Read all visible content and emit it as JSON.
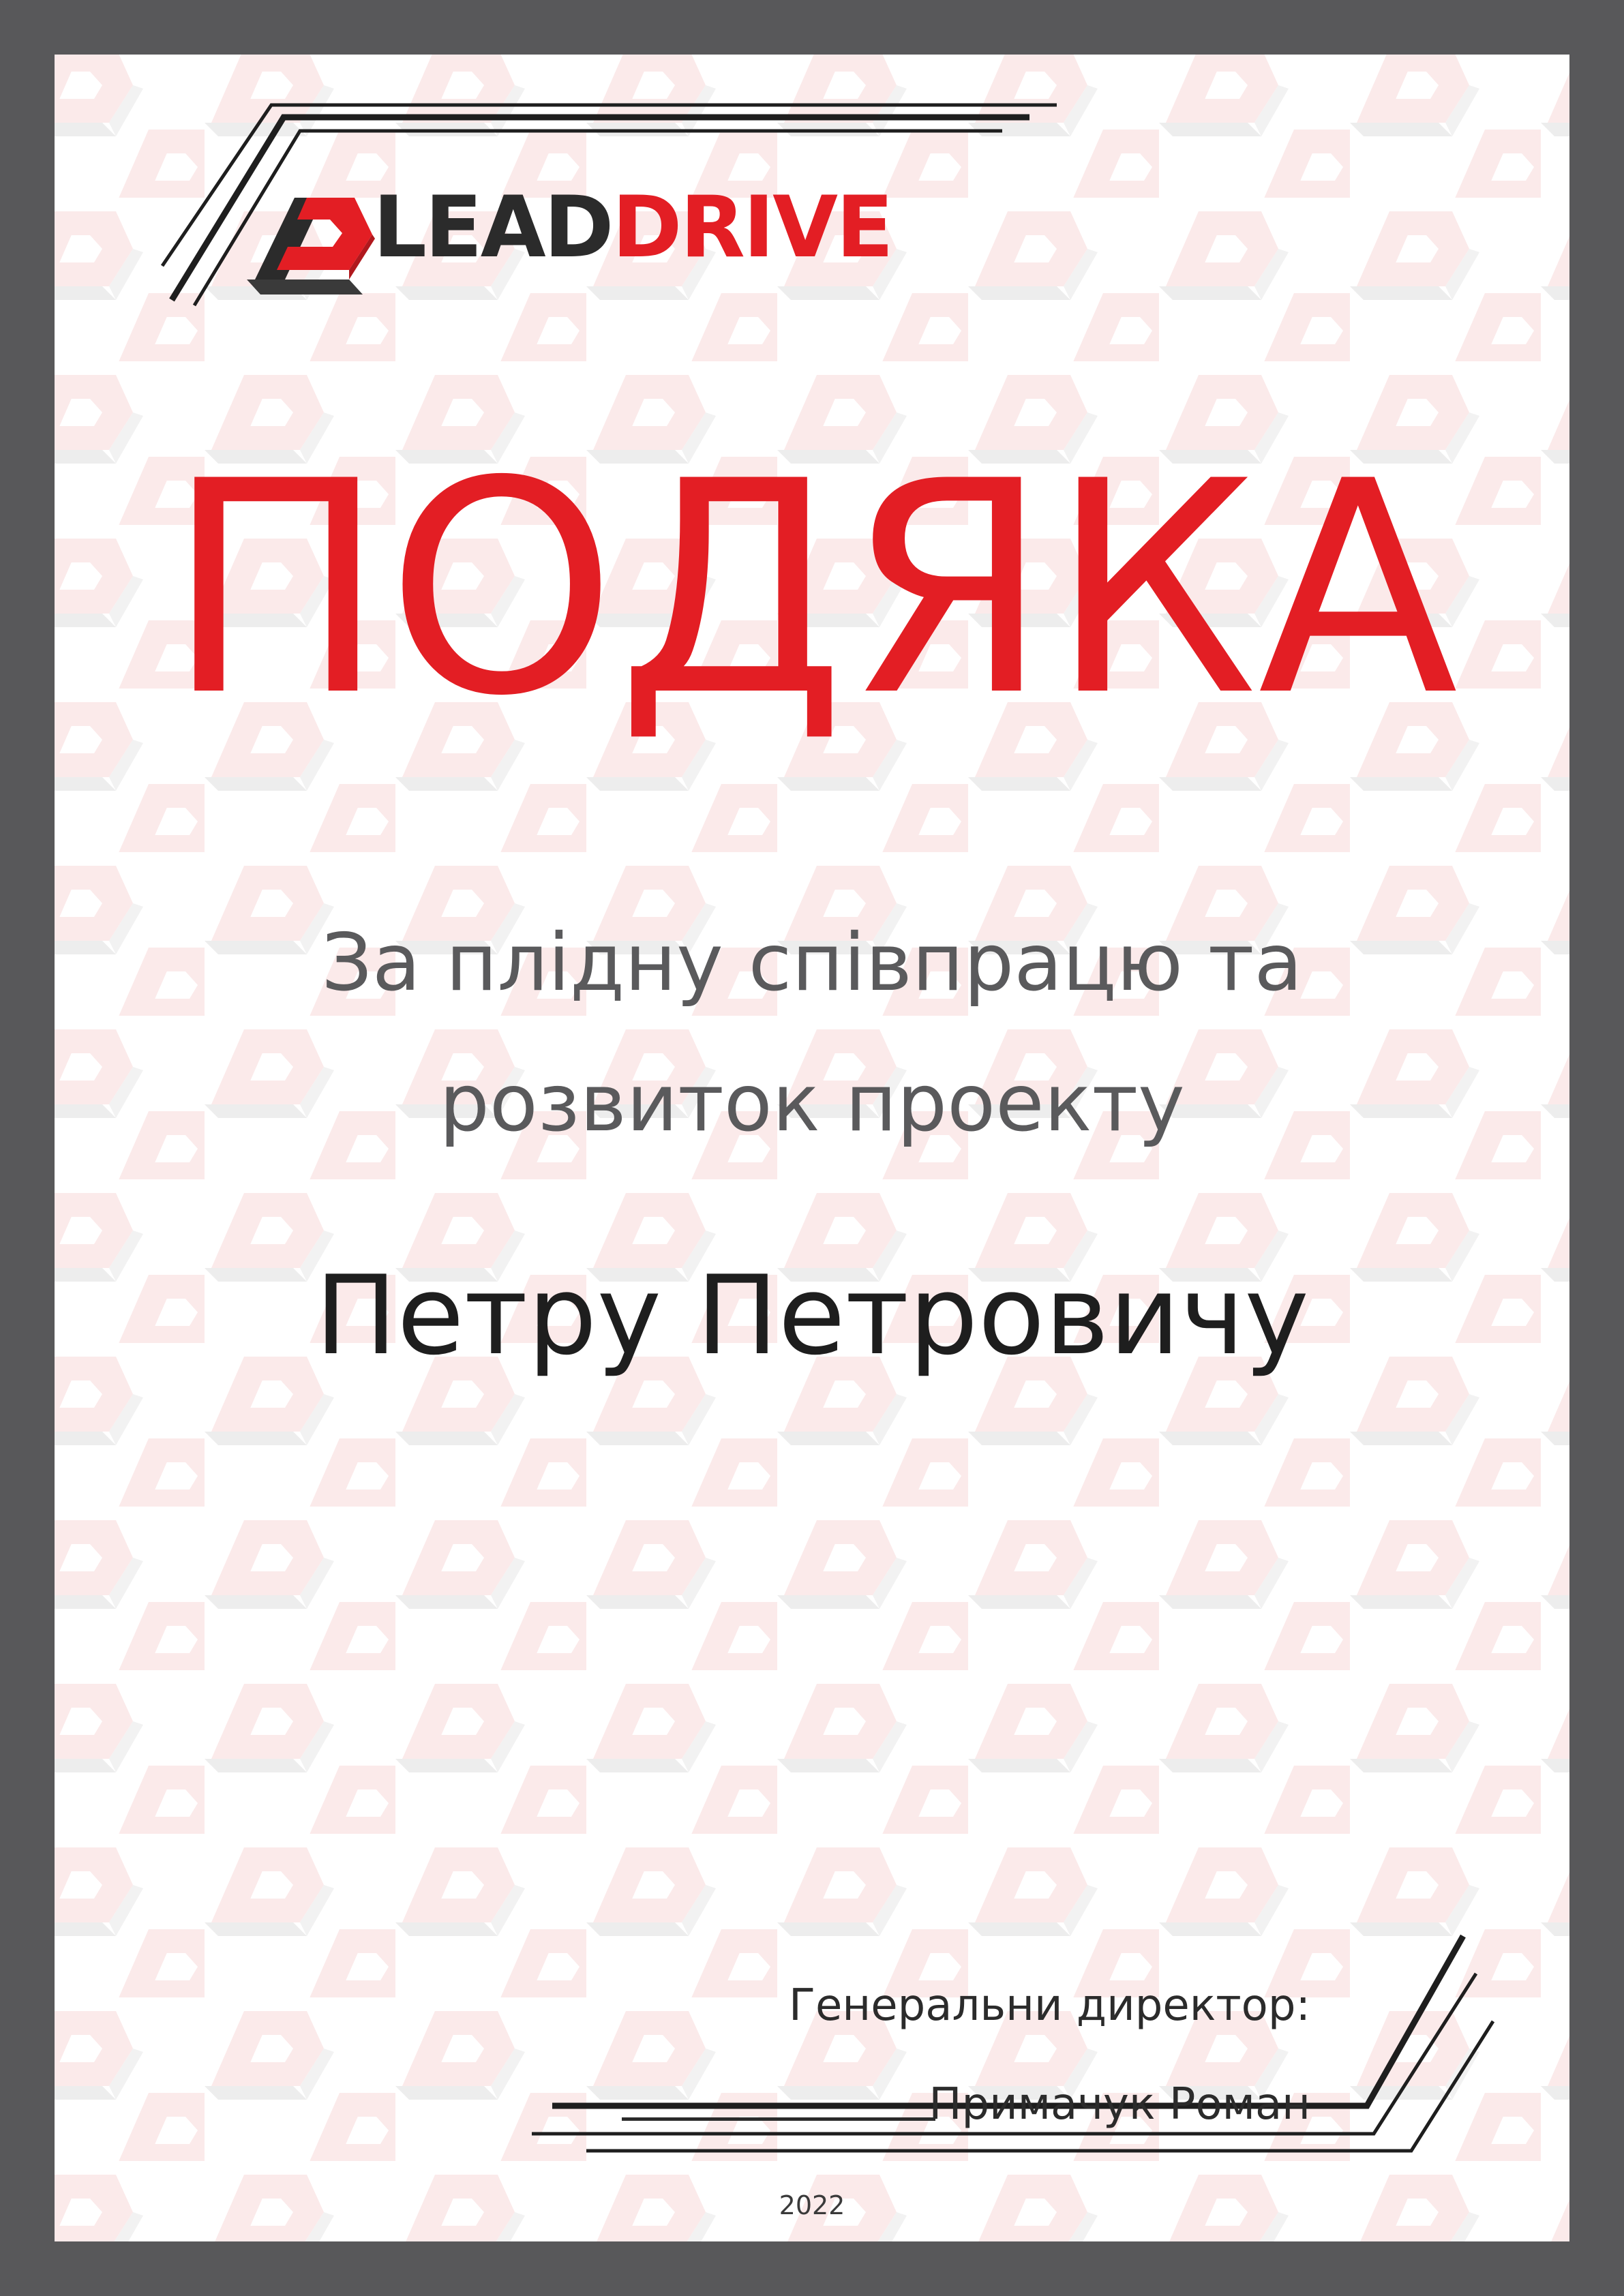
{
  "logo": {
    "text_part1": "LEAD",
    "text_part2": "DRIVE"
  },
  "certificate": {
    "title": "ПОДЯКА",
    "subtitle_line1": "За плідну співпрацю та",
    "subtitle_line2": "розвиток проекту",
    "recipient": "Петру Петровичу"
  },
  "signature": {
    "role": "Генеральни директор:",
    "name": "Примачук Роман"
  },
  "year": "2022",
  "colors": {
    "brand_red": "#e31e24",
    "dark": "#2b2b2b",
    "frame": "#58585a",
    "text_grey": "#5a5a5c"
  },
  "icons": {
    "logo_mark": "leaddrive-logo-mark",
    "watermark": "leaddrive-watermark-pattern"
  }
}
